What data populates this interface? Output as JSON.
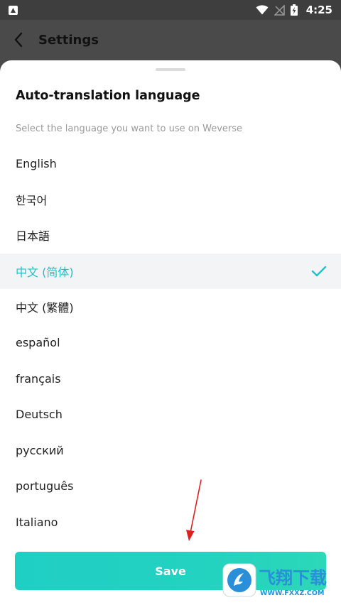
{
  "status_bar": {
    "time": "4:25",
    "icons": [
      "notification-icon",
      "wifi-icon",
      "no-signal-icon",
      "battery-charging-icon"
    ]
  },
  "app_bar": {
    "title": "Settings",
    "back_icon": "chevron-left-icon"
  },
  "sheet": {
    "title": "Auto-translation language",
    "subtitle": "Select the language you want to use on Weverse",
    "languages": [
      {
        "label": "English",
        "selected": false
      },
      {
        "label": "한국어",
        "selected": false
      },
      {
        "label": "日本語",
        "selected": false
      },
      {
        "label": "中文 (简体)",
        "selected": true
      },
      {
        "label": "中文 (繁體)",
        "selected": false
      },
      {
        "label": "español",
        "selected": false
      },
      {
        "label": "français",
        "selected": false
      },
      {
        "label": "Deutsch",
        "selected": false
      },
      {
        "label": "русский",
        "selected": false
      },
      {
        "label": "português",
        "selected": false
      },
      {
        "label": "Italiano",
        "selected": false
      }
    ],
    "save_label": "Save"
  },
  "watermark": {
    "text": "飞翔下载",
    "url": "WWW.FXXZ.COM"
  },
  "colors": {
    "accent": "#1ec2c6",
    "annotation": "#e02020",
    "watermark_blue": "#2a8fd6"
  }
}
